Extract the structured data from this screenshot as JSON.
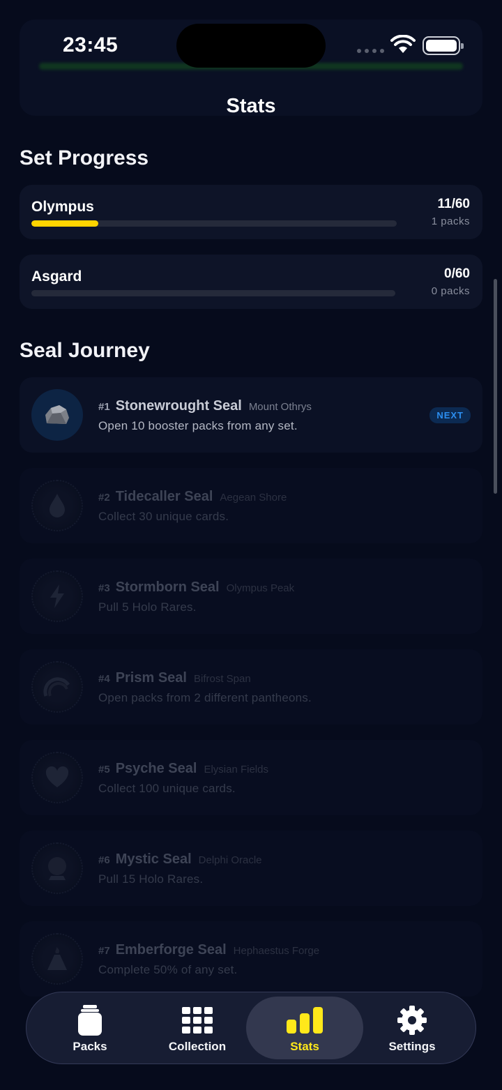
{
  "status_bar": {
    "time": "23:45"
  },
  "nav": {
    "title": "Stats"
  },
  "set_progress": {
    "title": "Set Progress",
    "sets": [
      {
        "name": "Olympus",
        "count": "11/60",
        "packs": "1 packs",
        "progress": 0.183,
        "color": "#ffd400"
      },
      {
        "name": "Asgard",
        "count": "0/60",
        "packs": "0 packs",
        "progress": 0.0,
        "color": "#ffd400"
      }
    ]
  },
  "seal_journey": {
    "title": "Seal Journey",
    "next_label": "NEXT",
    "seals": [
      {
        "num": "#1",
        "name": "Stonewrought Seal",
        "place": "Mount Othrys",
        "desc": "Open 10 booster packs from any set.",
        "icon": "stone-icon",
        "state": "next"
      },
      {
        "num": "#2",
        "name": "Tidecaller Seal",
        "place": "Aegean Shore",
        "desc": "Collect 30 unique cards.",
        "icon": "water-drop-icon",
        "state": "locked"
      },
      {
        "num": "#3",
        "name": "Stormborn Seal",
        "place": "Olympus Peak",
        "desc": "Pull 5 Holo Rares.",
        "icon": "lightning-icon",
        "state": "locked"
      },
      {
        "num": "#4",
        "name": "Prism Seal",
        "place": "Bifrost Span",
        "desc": "Open packs from 2 different pantheons.",
        "icon": "rainbow-icon",
        "state": "locked"
      },
      {
        "num": "#5",
        "name": "Psyche Seal",
        "place": "Elysian Fields",
        "desc": "Collect 100 unique cards.",
        "icon": "heart-icon",
        "state": "locked"
      },
      {
        "num": "#6",
        "name": "Mystic Seal",
        "place": "Delphi Oracle",
        "desc": "Pull 15 Holo Rares.",
        "icon": "crystal-ball-icon",
        "state": "locked"
      },
      {
        "num": "#7",
        "name": "Emberforge Seal",
        "place": "Hephaestus Forge",
        "desc": "Complete 50% of any set.",
        "icon": "volcano-icon",
        "state": "locked"
      }
    ]
  },
  "tab_bar": {
    "tabs": [
      {
        "label": "Packs",
        "icon": "pack-icon",
        "active": false
      },
      {
        "label": "Collection",
        "icon": "grid-icon",
        "active": false
      },
      {
        "label": "Stats",
        "icon": "bar-chart-icon",
        "active": true
      },
      {
        "label": "Settings",
        "icon": "gear-icon",
        "active": false
      }
    ],
    "active_color": "#ffe81a"
  }
}
